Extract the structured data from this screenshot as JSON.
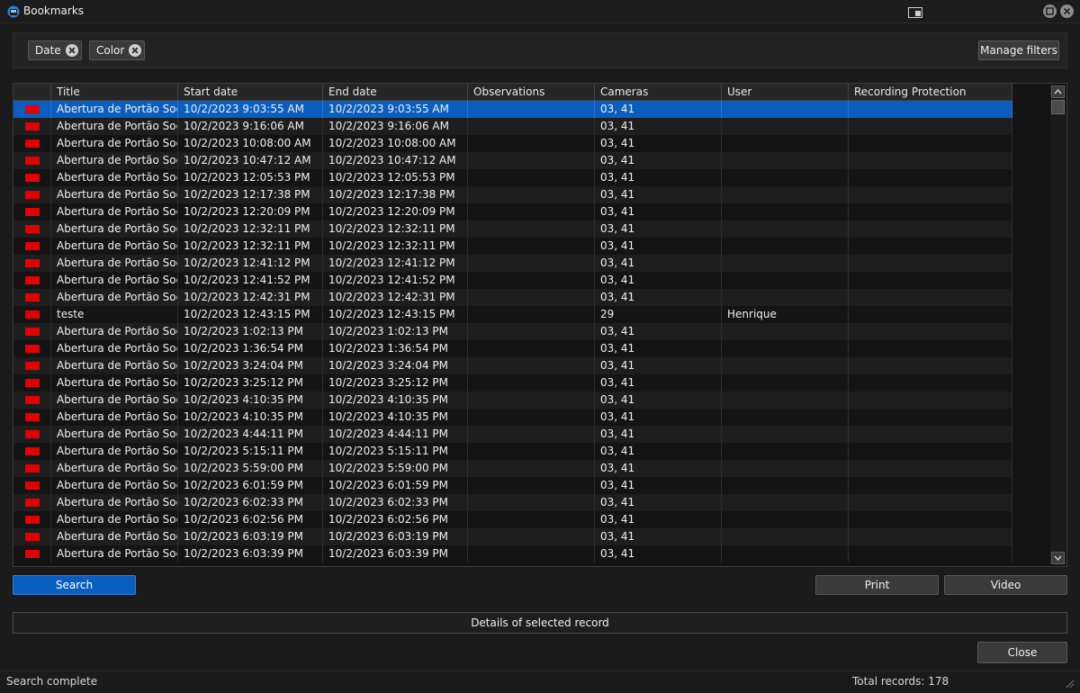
{
  "window": {
    "title": "Bookmarks"
  },
  "filters": {
    "chips": [
      {
        "label": "Date"
      },
      {
        "label": "Color"
      }
    ],
    "manage_label": "Manage filters"
  },
  "columns": [
    "",
    "Title",
    "Start date",
    "End date",
    "Observations",
    "Cameras",
    "User",
    "Recording Protection"
  ],
  "swatch_color": "#e40000",
  "selection_color": "#0a5ec0",
  "rows": [
    {
      "title": "Abertura de Portão Social",
      "start": "10/2/2023 9:03:55 AM",
      "end": "10/2/2023 9:03:55 AM",
      "observations": "",
      "cameras": "03, 41",
      "user": "",
      "protection": ""
    },
    {
      "title": "Abertura de Portão Social",
      "start": "10/2/2023 9:16:06 AM",
      "end": "10/2/2023 9:16:06 AM",
      "observations": "",
      "cameras": "03, 41",
      "user": "",
      "protection": ""
    },
    {
      "title": "Abertura de Portão Social",
      "start": "10/2/2023 10:08:00 AM",
      "end": "10/2/2023 10:08:00 AM",
      "observations": "",
      "cameras": "03, 41",
      "user": "",
      "protection": ""
    },
    {
      "title": "Abertura de Portão Social",
      "start": "10/2/2023 10:47:12 AM",
      "end": "10/2/2023 10:47:12 AM",
      "observations": "",
      "cameras": "03, 41",
      "user": "",
      "protection": ""
    },
    {
      "title": "Abertura de Portão Social",
      "start": "10/2/2023 12:05:53 PM",
      "end": "10/2/2023 12:05:53 PM",
      "observations": "",
      "cameras": "03, 41",
      "user": "",
      "protection": ""
    },
    {
      "title": "Abertura de Portão Social",
      "start": "10/2/2023 12:17:38 PM",
      "end": "10/2/2023 12:17:38 PM",
      "observations": "",
      "cameras": "03, 41",
      "user": "",
      "protection": ""
    },
    {
      "title": "Abertura de Portão Social",
      "start": "10/2/2023 12:20:09 PM",
      "end": "10/2/2023 12:20:09 PM",
      "observations": "",
      "cameras": "03, 41",
      "user": "",
      "protection": ""
    },
    {
      "title": "Abertura de Portão Social",
      "start": "10/2/2023 12:32:11 PM",
      "end": "10/2/2023 12:32:11 PM",
      "observations": "",
      "cameras": "03, 41",
      "user": "",
      "protection": ""
    },
    {
      "title": "Abertura de Portão Social",
      "start": "10/2/2023 12:32:11 PM",
      "end": "10/2/2023 12:32:11 PM",
      "observations": "",
      "cameras": "03, 41",
      "user": "",
      "protection": ""
    },
    {
      "title": "Abertura de Portão Social",
      "start": "10/2/2023 12:41:12 PM",
      "end": "10/2/2023 12:41:12 PM",
      "observations": "",
      "cameras": "03, 41",
      "user": "",
      "protection": ""
    },
    {
      "title": "Abertura de Portão Social",
      "start": "10/2/2023 12:41:52 PM",
      "end": "10/2/2023 12:41:52 PM",
      "observations": "",
      "cameras": "03, 41",
      "user": "",
      "protection": ""
    },
    {
      "title": "Abertura de Portão Social",
      "start": "10/2/2023 12:42:31 PM",
      "end": "10/2/2023 12:42:31 PM",
      "observations": "",
      "cameras": "03, 41",
      "user": "",
      "protection": ""
    },
    {
      "title": "teste",
      "start": "10/2/2023 12:43:15 PM",
      "end": "10/2/2023 12:43:15 PM",
      "observations": "",
      "cameras": "29",
      "user": "Henrique",
      "protection": ""
    },
    {
      "title": "Abertura de Portão Social",
      "start": "10/2/2023 1:02:13 PM",
      "end": "10/2/2023 1:02:13 PM",
      "observations": "",
      "cameras": "03, 41",
      "user": "",
      "protection": ""
    },
    {
      "title": "Abertura de Portão Social",
      "start": "10/2/2023 1:36:54 PM",
      "end": "10/2/2023 1:36:54 PM",
      "observations": "",
      "cameras": "03, 41",
      "user": "",
      "protection": ""
    },
    {
      "title": "Abertura de Portão Social",
      "start": "10/2/2023 3:24:04 PM",
      "end": "10/2/2023 3:24:04 PM",
      "observations": "",
      "cameras": "03, 41",
      "user": "",
      "protection": ""
    },
    {
      "title": "Abertura de Portão Social",
      "start": "10/2/2023 3:25:12 PM",
      "end": "10/2/2023 3:25:12 PM",
      "observations": "",
      "cameras": "03, 41",
      "user": "",
      "protection": ""
    },
    {
      "title": "Abertura de Portão Social",
      "start": "10/2/2023 4:10:35 PM",
      "end": "10/2/2023 4:10:35 PM",
      "observations": "",
      "cameras": "03, 41",
      "user": "",
      "protection": ""
    },
    {
      "title": "Abertura de Portão Social",
      "start": "10/2/2023 4:10:35 PM",
      "end": "10/2/2023 4:10:35 PM",
      "observations": "",
      "cameras": "03, 41",
      "user": "",
      "protection": ""
    },
    {
      "title": "Abertura de Portão Social",
      "start": "10/2/2023 4:44:11 PM",
      "end": "10/2/2023 4:44:11 PM",
      "observations": "",
      "cameras": "03, 41",
      "user": "",
      "protection": ""
    },
    {
      "title": "Abertura de Portão Social",
      "start": "10/2/2023 5:15:11 PM",
      "end": "10/2/2023 5:15:11 PM",
      "observations": "",
      "cameras": "03, 41",
      "user": "",
      "protection": ""
    },
    {
      "title": "Abertura de Portão Social",
      "start": "10/2/2023 5:59:00 PM",
      "end": "10/2/2023 5:59:00 PM",
      "observations": "",
      "cameras": "03, 41",
      "user": "",
      "protection": ""
    },
    {
      "title": "Abertura de Portão Social",
      "start": "10/2/2023 6:01:59 PM",
      "end": "10/2/2023 6:01:59 PM",
      "observations": "",
      "cameras": "03, 41",
      "user": "",
      "protection": ""
    },
    {
      "title": "Abertura de Portão Social",
      "start": "10/2/2023 6:02:33 PM",
      "end": "10/2/2023 6:02:33 PM",
      "observations": "",
      "cameras": "03, 41",
      "user": "",
      "protection": ""
    },
    {
      "title": "Abertura de Portão Social",
      "start": "10/2/2023 6:02:56 PM",
      "end": "10/2/2023 6:02:56 PM",
      "observations": "",
      "cameras": "03, 41",
      "user": "",
      "protection": ""
    },
    {
      "title": "Abertura de Portão Social",
      "start": "10/2/2023 6:03:19 PM",
      "end": "10/2/2023 6:03:19 PM",
      "observations": "",
      "cameras": "03, 41",
      "user": "",
      "protection": ""
    },
    {
      "title": "Abertura de Portão Social",
      "start": "10/2/2023 6:03:39 PM",
      "end": "10/2/2023 6:03:39 PM",
      "observations": "",
      "cameras": "03, 41",
      "user": "",
      "protection": ""
    }
  ],
  "actions": {
    "search_label": "Search",
    "print_label": "Print",
    "video_label": "Video",
    "details_label": "Details of selected record",
    "close_label": "Close"
  },
  "status": {
    "message": "Search complete",
    "total": "Total records: 178"
  }
}
